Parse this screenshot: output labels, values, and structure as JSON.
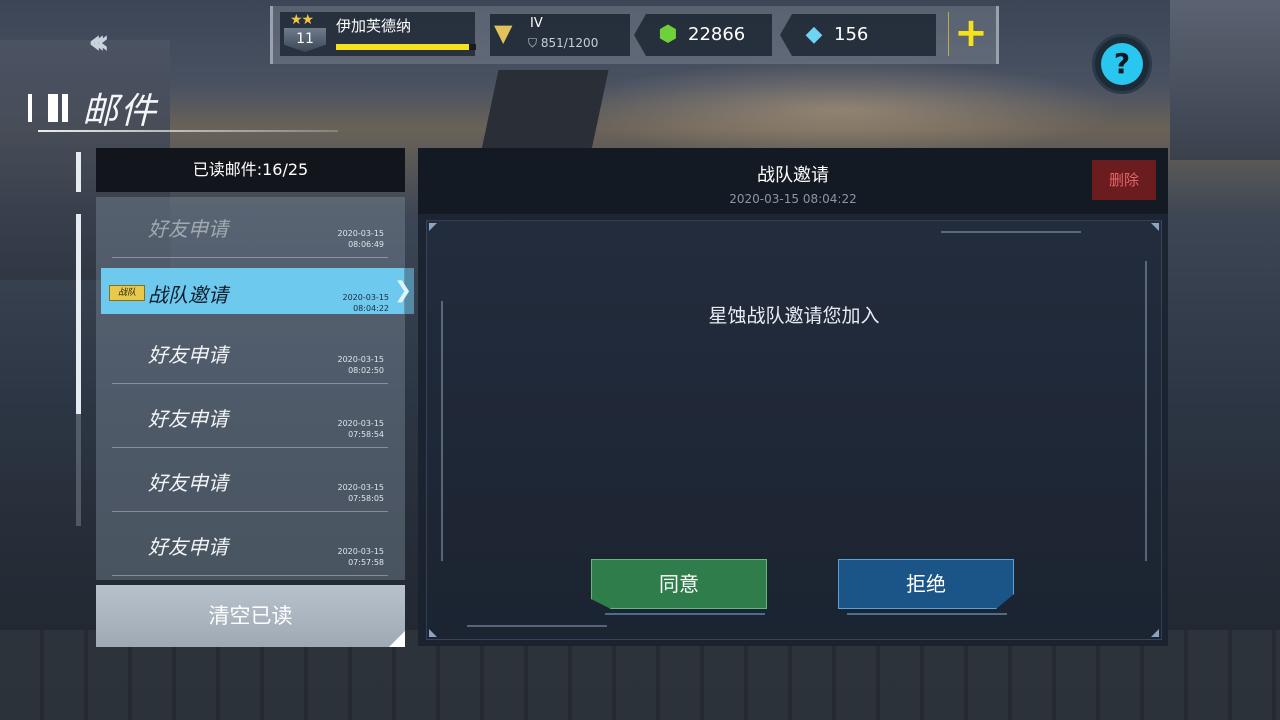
{
  "topbar": {
    "player_name": "伊加芙德纳",
    "player_level": "11",
    "player_stars": "★★",
    "xp_fraction": 0.95,
    "tier_label": "IV",
    "tier_progress": "851/1200",
    "green_currency": "22866",
    "gem_currency": "156",
    "add_label": "+",
    "help_label": "?"
  },
  "page": {
    "title": "邮件",
    "back_label": "‹‹‹"
  },
  "mail_list": {
    "header": "已读邮件:16/25",
    "items": [
      {
        "title": "好友申请",
        "date": "2020-03-15",
        "time": "08:06:49",
        "state": "faded"
      },
      {
        "title": "战队邀请",
        "date": "2020-03-15",
        "time": "08:04:22",
        "state": "selected",
        "badge": "战队"
      },
      {
        "title": "好友申请",
        "date": "2020-03-15",
        "time": "08:02:50",
        "state": "normal"
      },
      {
        "title": "好友申请",
        "date": "2020-03-15",
        "time": "07:58:54",
        "state": "normal"
      },
      {
        "title": "好友申请",
        "date": "2020-03-15",
        "time": "07:58:05",
        "state": "normal"
      },
      {
        "title": "好友申请",
        "date": "2020-03-15",
        "time": "07:57:58",
        "state": "normal"
      }
    ],
    "clear_label": "清空已读"
  },
  "detail": {
    "title": "战队邀请",
    "datetime": "2020-03-15 08:04:22",
    "delete_label": "删除",
    "message": "星蚀战队邀请您加入",
    "accept_label": "同意",
    "reject_label": "拒绝"
  },
  "colors": {
    "selected_row": "#6ec9ee",
    "accept": "#2e7d4a",
    "reject": "#1b5588",
    "delete": "#6b1c1f",
    "xp_bar": "#f4e21d",
    "help": "#29c6ef"
  },
  "icons": {
    "back": "triple-chevron-left-icon",
    "tier": "winged-rank-emblem-icon",
    "green_currency": "green-crystal-icon",
    "gem_currency": "diamond-icon",
    "add": "plus-icon",
    "help": "question-icon"
  }
}
